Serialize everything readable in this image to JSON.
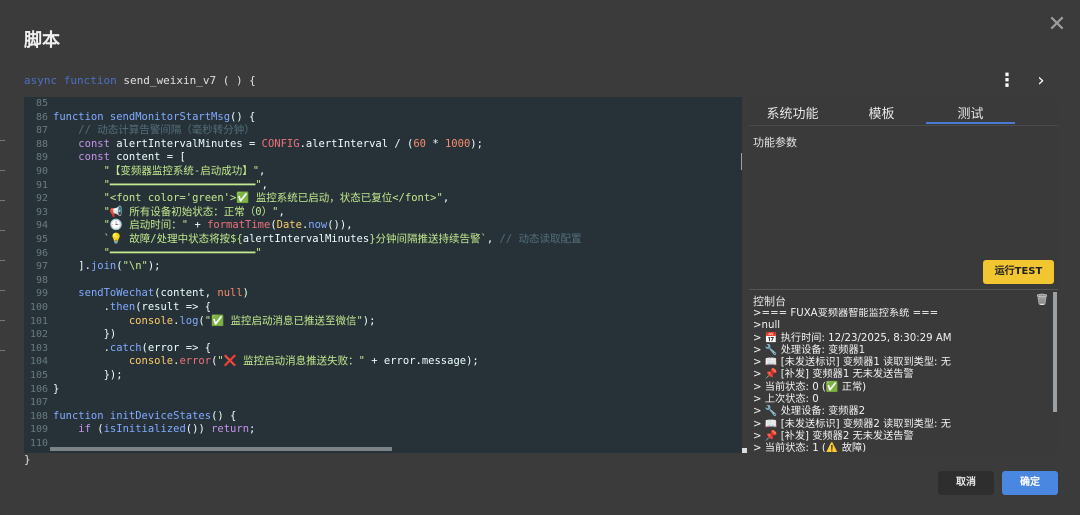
{
  "dialog": {
    "title": "脚本",
    "close_glyph": "✕",
    "signature": {
      "async": "async",
      "function": "function",
      "rest": " send_weixin_v7 ( ) {"
    },
    "more_glyph": "⋮",
    "next_glyph": "›",
    "closing_brace": "}"
  },
  "code_lines": [
    {
      "n": "85",
      "html": ""
    },
    {
      "n": "86",
      "html": "<span style='color:#82aaff'>function</span> <span style='color:#82aaff'>sendMonitorStartMsg</span>() {"
    },
    {
      "n": "87",
      "html": "    <span style='color:#546e7a'>// 动态计算告警间隔（毫秒转分钟）</span>"
    },
    {
      "n": "88",
      "html": "    <span style='color:#c792ea'>const</span> alertIntervalMinutes = <span style='color:#f07178'>CONFIG</span>.alertInterval / (<span style='color:#f78c6c'>60</span> * <span style='color:#f78c6c'>1000</span>);"
    },
    {
      "n": "89",
      "html": "    <span style='color:#c792ea'>const</span> content = ["
    },
    {
      "n": "90",
      "html": "        <span style='color:#c3e88d'>\"【变频器监控系统-启动成功】\"</span>,"
    },
    {
      "n": "91",
      "html": "        <span style='color:#c3e88d'>\"━━━━━━━━━━━━━━━━━━━━━━━\"</span>,"
    },
    {
      "n": "92",
      "html": "        <span style='color:#c3e88d'>\"&lt;font color='green'&gt;✅ 监控系统已启动，状态已复位&lt;/font&gt;\"</span>,"
    },
    {
      "n": "93",
      "html": "        <span style='color:#c3e88d'>\"📢 所有设备初始状态：正常（0）\"</span>,"
    },
    {
      "n": "94",
      "html": "        <span style='color:#c3e88d'>\"🕒 启动时间：\"</span> + <span style='color:#f07178'>formatTime</span>(<span style='color:#ffcb6b'>Date</span>.<span style='color:#82aaff'>now</span>()),"
    },
    {
      "n": "95",
      "html": "        <span style='color:#c3e88d'>`💡 故障/处理中状态将按${</span>alertIntervalMinutes<span style='color:#c3e88d'>}分钟间隔推送持续告警`</span>, <span style='color:#546e7a'>// 动态读取配置</span>"
    },
    {
      "n": "96",
      "html": "        <span style='color:#c3e88d'>\"━━━━━━━━━━━━━━━━━━━━━━━\"</span>"
    },
    {
      "n": "97",
      "html": "    ].<span style='color:#82aaff'>join</span>(<span style='color:#c3e88d'>\"\\n\"</span>);"
    },
    {
      "n": "98",
      "html": ""
    },
    {
      "n": "99",
      "html": "    <span style='color:#82aaff'>sendToWechat</span>(content, <span style='color:#f78c6c'>null</span>)"
    },
    {
      "n": "100",
      "html": "        .<span style='color:#82aaff'>then</span>(result =&gt; {"
    },
    {
      "n": "101",
      "html": "            <span style='color:#ffcb6b'>console</span>.<span style='color:#82aaff'>log</span>(<span style='color:#c3e88d'>\"✅ 监控启动消息已推送至微信\"</span>);"
    },
    {
      "n": "102",
      "html": "        })"
    },
    {
      "n": "103",
      "html": "        .<span style='color:#82aaff'>catch</span>(error =&gt; {"
    },
    {
      "n": "104",
      "html": "            <span style='color:#ffcb6b'>console</span>.<span style='color:#f07178'>error</span>(<span style='color:#c3e88d'>\"❌ 监控启动消息推送失败：\"</span> + error.message);"
    },
    {
      "n": "105",
      "html": "        });"
    },
    {
      "n": "106",
      "html": "}"
    },
    {
      "n": "107",
      "html": ""
    },
    {
      "n": "108",
      "html": "<span style='color:#82aaff'>function</span> <span style='color:#82aaff'>initDeviceStates</span>() {"
    },
    {
      "n": "109",
      "html": "    <span style='color:#c792ea'>if</span> (<span style='color:#82aaff'>isInitialized</span>()) <span style='color:#c792ea'>return</span>;"
    },
    {
      "n": "110",
      "html": ""
    }
  ],
  "panel": {
    "tabs": [
      "系统功能",
      "模板",
      "测试"
    ],
    "active_tab": "测试",
    "params_label": "功能参数",
    "run_button": "运行TEST",
    "console_label": "控制台",
    "clear_glyph": "🗑",
    "console_lines": [
      ">=== FUXA变频器智能监控系统 ===",
      ">null",
      "> 📅 执行时间: 12/23/2025, 8:30:29 AM",
      "> 🔧 处理设备: 变频器1",
      "> 📖 [未发送标识] 变频器1 读取到类型: 无",
      "> 📌 [补发] 变频器1 无未发送告警",
      "> 当前状态: 0 (✅ 正常)",
      "> 上次状态: 0",
      "> 🔧 处理设备: 变频器2",
      "> 📖 [未发送标识] 变频器2 读取到类型: 无",
      "> 📌 [补发] 变频器2 无未发送告警",
      "> 当前状态: 1 (⚠️ 故障)"
    ]
  },
  "footer": {
    "cancel": "取消",
    "ok": "确定"
  },
  "colors": {
    "accent": "#4a87e0",
    "run_button": "#f2c630",
    "editor_bg": "#263238"
  }
}
